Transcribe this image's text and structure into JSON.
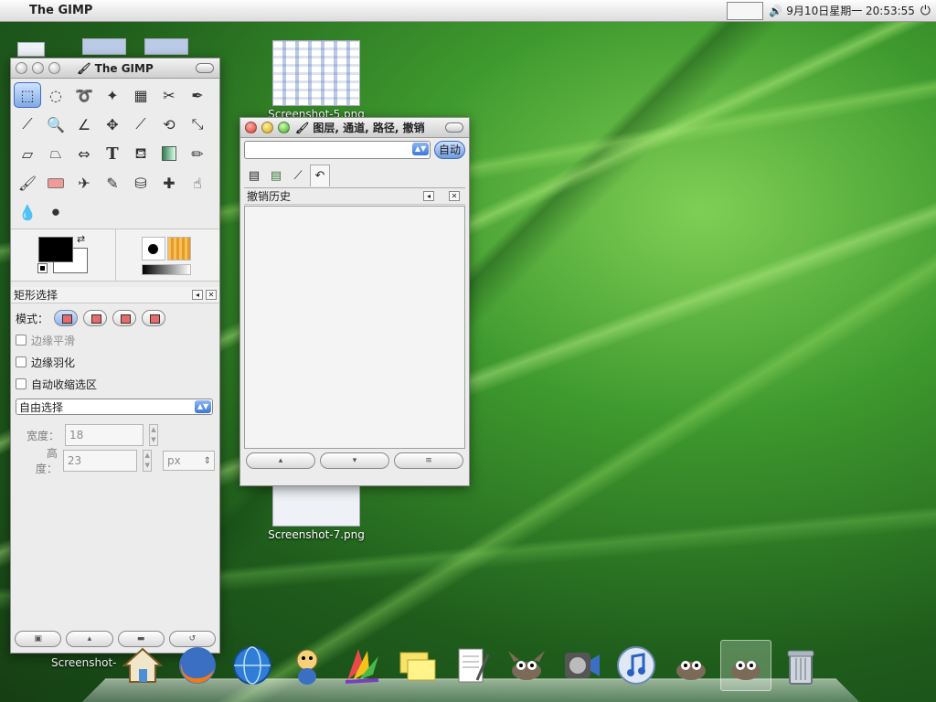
{
  "menubar": {
    "app_name": "The GIMP",
    "clock": "9月10日星期一 20:53:55",
    "volume_icon": "speaker-icon",
    "power_icon": "power-icon"
  },
  "desktop": {
    "icons": [
      {
        "label": "Screenshot-5.png"
      },
      {
        "label": "Screenshot-7.png"
      },
      {
        "label": "Screenshot-"
      }
    ]
  },
  "toolbox": {
    "title": "The GIMP",
    "tools": [
      "rect-select",
      "ellipse-select",
      "free-select",
      "fuzzy-select",
      "select-by-color",
      "scissors",
      "paths",
      "color-picker",
      "zoom",
      "measure",
      "move",
      "crop",
      "rotate",
      "scale",
      "shear",
      "perspective",
      "flip",
      "text",
      "bucket-fill",
      "blend",
      "pencil",
      "paintbrush",
      "eraser",
      "airbrush",
      "ink",
      "clone",
      "heal",
      "smudge",
      "blur",
      "dodge-burn"
    ],
    "options": {
      "title": "矩形选择",
      "mode_label": "模式：",
      "antialias_label": "边缘平滑",
      "feather_label": "边缘羽化",
      "autoshrink_label": "自动收缩选区",
      "select_mode": "自由选择",
      "width_label": "宽度：",
      "width_value": "18",
      "height_label": "高度：",
      "height_value": "23",
      "unit": "px"
    }
  },
  "layers": {
    "title": "图层, 通道, 路径, 撤销",
    "auto_label": "自动",
    "panel_title": "撤销历史"
  },
  "dock": {
    "items": [
      "home",
      "firefox",
      "network",
      "wine",
      "photo",
      "notes",
      "text-editor",
      "gimp",
      "media",
      "itunes",
      "gimp-2",
      "gimp-3",
      "trash"
    ]
  }
}
